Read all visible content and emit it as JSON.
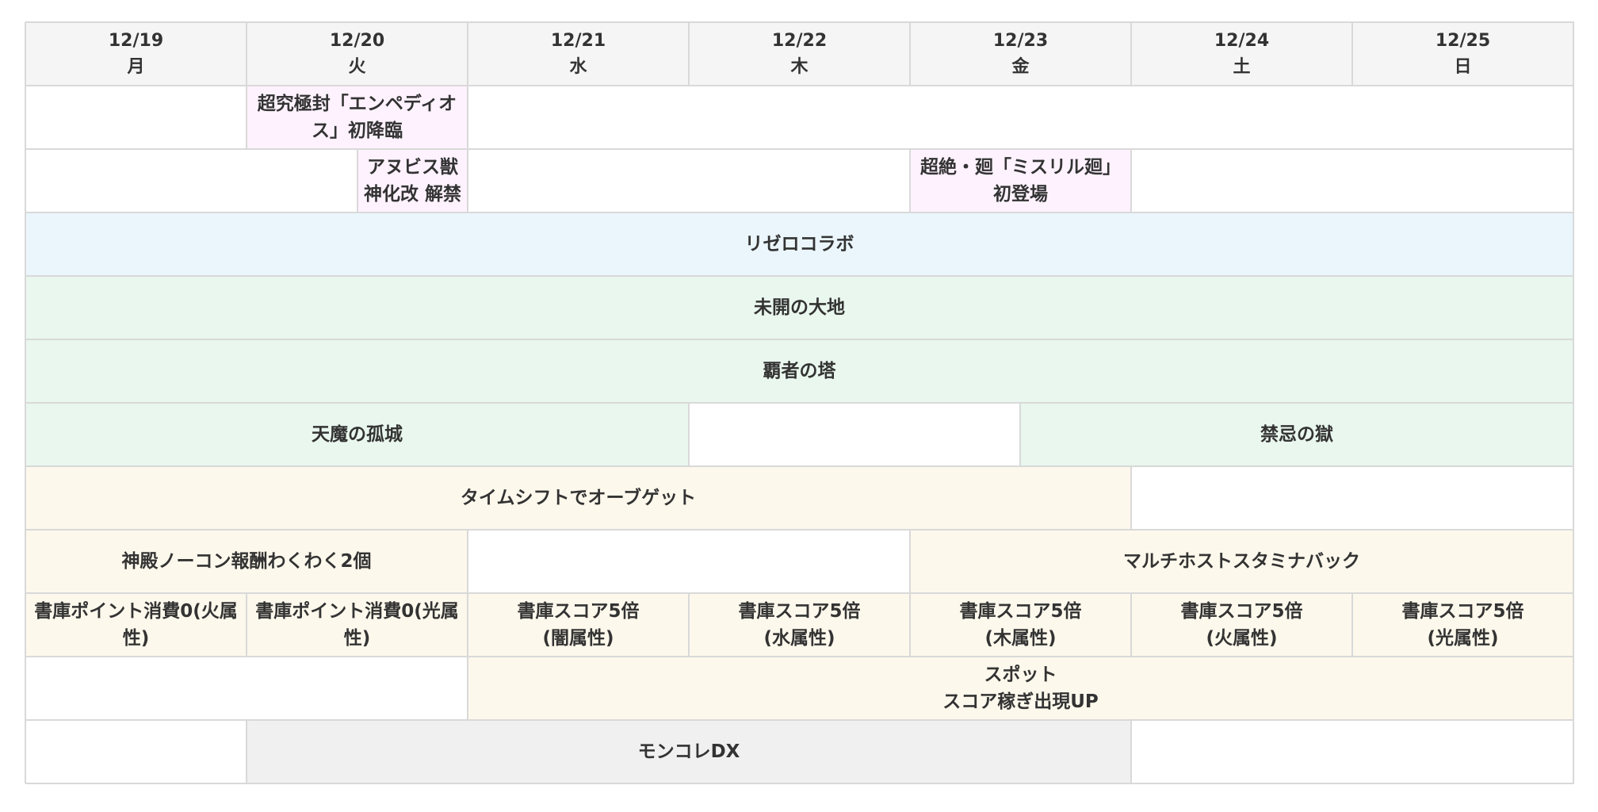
{
  "header": [
    {
      "date": "12/19",
      "day": "月"
    },
    {
      "date": "12/20",
      "day": "火"
    },
    {
      "date": "12/21",
      "day": "水"
    },
    {
      "date": "12/22",
      "day": "木"
    },
    {
      "date": "12/23",
      "day": "金"
    },
    {
      "date": "12/24",
      "day": "土"
    },
    {
      "date": "12/25",
      "day": "日"
    }
  ],
  "events": {
    "empeditos": "超究極封「エンペディオス」初降臨",
    "anubis": "アヌビス獣神化改 解禁",
    "mithril": "超絶・廻「ミスリル廻」初登場",
    "rezero": "リゼロコラボ",
    "mikai": "未開の大地",
    "hasha": "覇者の塔",
    "tenma": "天魔の孤城",
    "kinki": "禁忌の獄",
    "timeshift": "タイムシフトでオーブゲット",
    "shinden": "神殿ノーコン報酬わくわく2個",
    "multihost": "マルチホストスタミナバック",
    "shoko_point_fire": "書庫ポイント消費0(火属性)",
    "shoko_point_light": "書庫ポイント消費0(光属性)",
    "shoko_score_dark": "書庫スコア5倍\n(闇属性)",
    "shoko_score_water": "書庫スコア5倍\n(水属性)",
    "shoko_score_wood": "書庫スコア5倍\n(木属性)",
    "shoko_score_fire": "書庫スコア5倍\n(火属性)",
    "shoko_score_light": "書庫スコア5倍\n(光属性)",
    "spot": "スポット\nスコア稼ぎ出現UP",
    "monkore": "モンコレDX"
  },
  "colors": {
    "header_bg": "#f5f5f5",
    "pink": "#fdf2fd",
    "blue": "#eaf6fc",
    "green": "#e9f7ee",
    "cream": "#fdf8ec",
    "gray": "#f0f0f0",
    "border": "#d9d9d9",
    "text": "#333333"
  }
}
